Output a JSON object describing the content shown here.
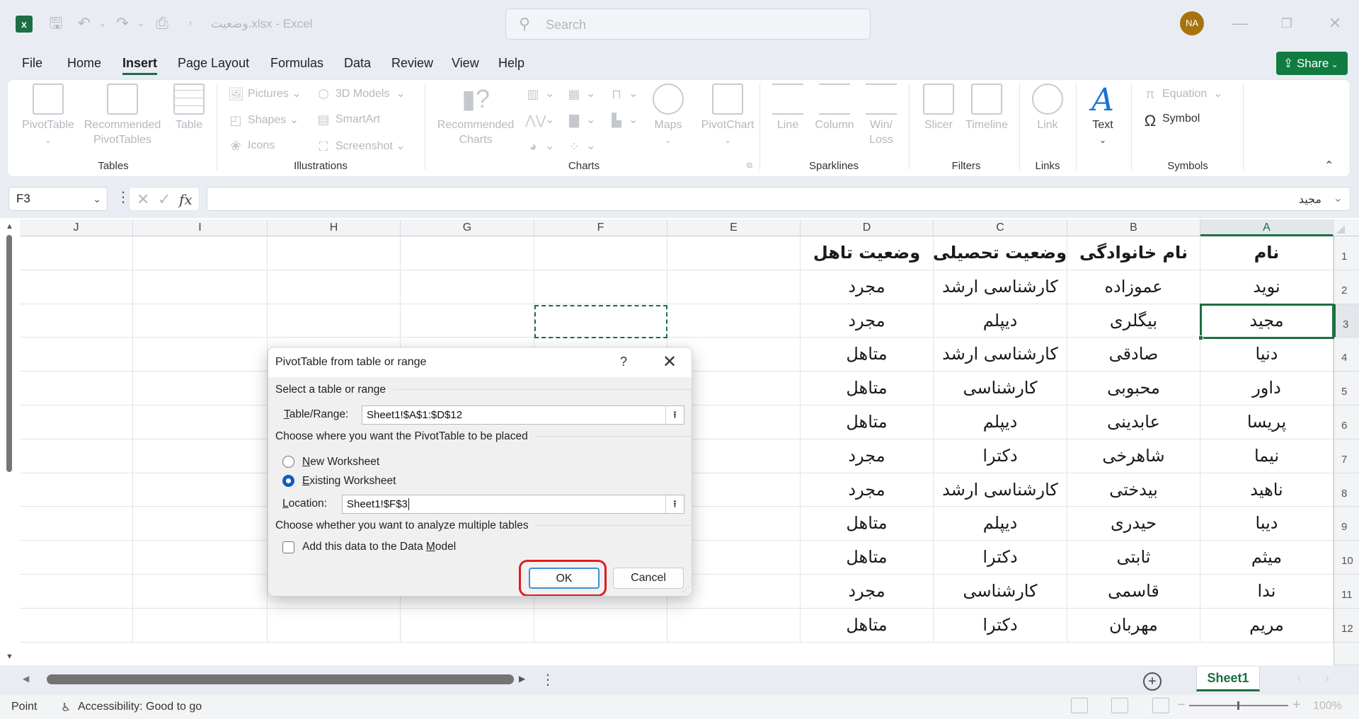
{
  "titlebar": {
    "app_icon": "excel-logo-icon",
    "app_letter": "x",
    "title": "وضعیت.xlsx - Excel",
    "quick_access": [
      "save-icon",
      "undo-icon",
      "redo-icon",
      "print-preview-icon",
      "customize-toolbar-icon"
    ],
    "search_placeholder": "Search",
    "avatar_initials": "NA",
    "window_buttons": [
      "minimize",
      "restore",
      "close"
    ]
  },
  "menu": {
    "tabs": [
      "File",
      "Home",
      "Insert",
      "Page Layout",
      "Formulas",
      "Data",
      "Review",
      "View",
      "Help"
    ],
    "active": "Insert",
    "share_label": "Share"
  },
  "ribbon": {
    "groups": {
      "tables": {
        "label": "Tables",
        "items": [
          "PivotTable",
          "Recommended PivotTables",
          "Table"
        ]
      },
      "illustrations": {
        "label": "Illustrations",
        "items": [
          "Pictures",
          "3D Models",
          "Shapes",
          "SmartArt",
          "Icons",
          "Screenshot"
        ]
      },
      "charts": {
        "label": "Charts",
        "items": [
          "Recommended Charts",
          "Maps",
          "PivotChart"
        ]
      },
      "sparklines": {
        "label": "Sparklines",
        "items": [
          "Line",
          "Column",
          "Win/ Loss"
        ]
      },
      "filters": {
        "label": "Filters",
        "items": [
          "Slicer",
          "Timeline"
        ]
      },
      "links": {
        "label": "Links",
        "items": [
          "Link"
        ]
      },
      "text": {
        "items": [
          "Text"
        ]
      },
      "symbols": {
        "label": "Symbols",
        "items": [
          "Equation",
          "Symbol"
        ]
      }
    },
    "labels": {
      "pivottable": "PivotTable",
      "rec_pivot_1": "Recommended",
      "rec_pivot_2": "PivotTables",
      "table": "Table",
      "pictures": "Pictures",
      "models3d": "3D Models",
      "shapes": "Shapes",
      "smartart": "SmartArt",
      "icons": "Icons",
      "screenshot": "Screenshot",
      "rec_charts_1": "Recommended",
      "rec_charts_2": "Charts",
      "maps": "Maps",
      "pivotchart": "PivotChart",
      "line": "Line",
      "column": "Column",
      "winloss_1": "Win/",
      "winloss_2": "Loss",
      "slicer": "Slicer",
      "timeline": "Timeline",
      "link": "Link",
      "text": "Text",
      "equation": "Equation",
      "symbol": "Symbol"
    }
  },
  "formula_bar": {
    "name_box": "F3",
    "formula_value": "مجید"
  },
  "sheet": {
    "columns_rtl": [
      "A",
      "B",
      "C",
      "D",
      "E",
      "F",
      "G",
      "H",
      "I",
      "J"
    ],
    "selected_column": "A",
    "selected_row": 3,
    "active_cell": "A3",
    "marquee_cell": "F3",
    "header_row": [
      "نام",
      "نام خانوادگی",
      "وضعیت تحصیلی",
      "وضعیت تاهل"
    ],
    "rows": [
      [
        "نوید",
        "عموزاده",
        "کارشناسی ارشد",
        "مجرد"
      ],
      [
        "مجید",
        "بیگلری",
        "دیپلم",
        "مجرد"
      ],
      [
        "دنیا",
        "صادقی",
        "کارشناسی ارشد",
        "متاهل"
      ],
      [
        "داور",
        "محبوبی",
        "کارشناسی",
        "متاهل"
      ],
      [
        "پریسا",
        "عابدینی",
        "دیپلم",
        "متاهل"
      ],
      [
        "نیما",
        "شاهرخی",
        "دکترا",
        "مجرد"
      ],
      [
        "ناهید",
        "بیدختی",
        "کارشناسی ارشد",
        "مجرد"
      ],
      [
        "دیبا",
        "حیدری",
        "دیپلم",
        "متاهل"
      ],
      [
        "میثم",
        "ثابتی",
        "دکترا",
        "متاهل"
      ],
      [
        "ندا",
        "قاسمی",
        "کارشناسی",
        "مجرد"
      ],
      [
        "مریم",
        "مهربان",
        "دکترا",
        "متاهل"
      ]
    ],
    "row_numbers": [
      "1",
      "2",
      "3",
      "4",
      "5",
      "6",
      "7",
      "8",
      "9",
      "10",
      "11",
      "12"
    ],
    "tab_name": "Sheet1"
  },
  "dialog": {
    "title": "PivotTable from table or range",
    "help": "?",
    "close": "✕",
    "section_select": "Select a table or range",
    "table_range_label_u": "T",
    "table_range_label_rest": "able/Range:",
    "table_range_value": "Sheet1!$A$1:$D$12",
    "section_place": "Choose where you want the PivotTable to be placed",
    "opt_new_u": "N",
    "opt_new_rest": "ew Worksheet",
    "opt_existing_u": "E",
    "opt_existing_rest": "xisting Worksheet",
    "selected_option": "Existing Worksheet",
    "location_label_u": "L",
    "location_label_rest": "ocation:",
    "location_value": "Sheet1!$F$3",
    "section_multi": "Choose whether you want to analyze multiple tables",
    "data_model_label_pre": "Add this data to the Data ",
    "data_model_label_u": "M",
    "data_model_label_rest": "odel",
    "data_model_checked": false,
    "ok_label": "OK",
    "cancel_label": "Cancel",
    "highlight_color": "#e01d1d"
  },
  "statusbar": {
    "mode": "Point",
    "accessibility": "Accessibility: Good to go",
    "zoom": "100%"
  },
  "colors": {
    "excel_green": "#1d6f42",
    "share_green": "#107c41",
    "avatar": "#a8730f",
    "radio_blue": "#0f5fb8"
  }
}
